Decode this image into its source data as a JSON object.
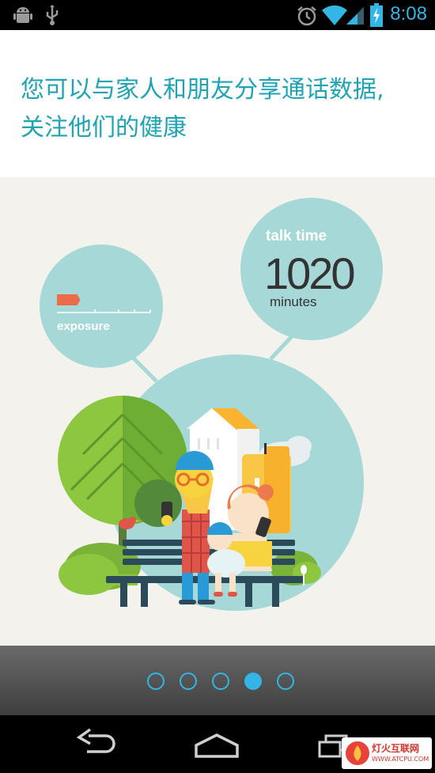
{
  "status_bar": {
    "time": "8:08",
    "left_icons": [
      "android-debug-icon",
      "usb-icon"
    ],
    "right_icons": [
      "alarm-icon",
      "wifi-icon",
      "signal-icon",
      "battery-charging-icon"
    ]
  },
  "header": {
    "line1": "您可以与家人和朋友分享通话数据,",
    "line2": "关注他们的健康"
  },
  "illustration": {
    "exposure_label": "exposure",
    "talk_time_label": "talk time",
    "talk_time_value": "1020",
    "talk_time_unit": "minutes",
    "exposure_level": 0.25
  },
  "pager": {
    "page_count": 5,
    "current_page": 4
  },
  "nav_bar": {
    "buttons": [
      "back-button",
      "home-button",
      "recents-button"
    ]
  },
  "watermark": {
    "title": "灯火互联网",
    "url": "WWW.ATCPU.COM"
  },
  "colors": {
    "accent": "#33b5e5",
    "header_text": "#1fa3b5",
    "bubble": "#a6d8d8",
    "exposure_bar": "#ee6b4a"
  }
}
